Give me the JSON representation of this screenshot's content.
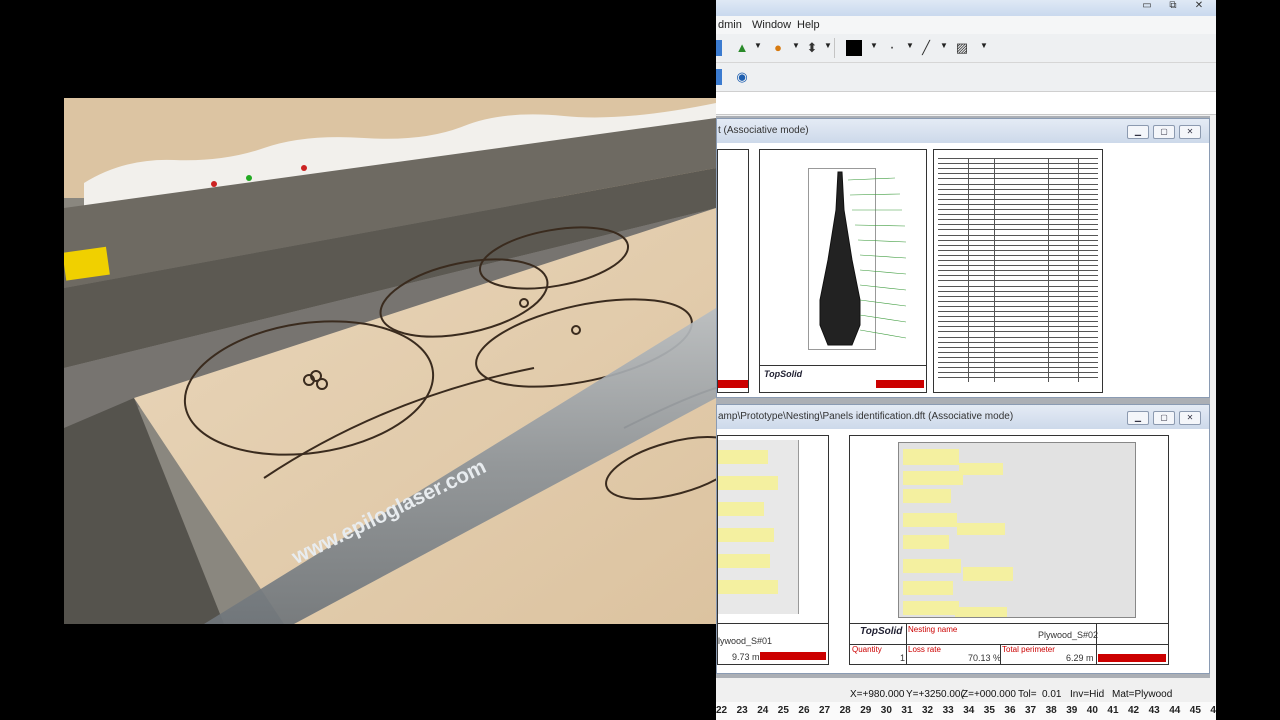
{
  "video": {
    "watermark": "www.epiloglaser.com"
  },
  "app": {
    "menu": {
      "admin": "dmin",
      "window": "Window",
      "help": "Help"
    },
    "window_controls": {
      "minimize": "▭",
      "restore": "⧉",
      "close": "✕"
    },
    "child_windows": [
      {
        "title": "t (Associative mode)",
        "title_block_logo": "TopSolid"
      },
      {
        "title": "amp\\Prototype\\Nesting\\Panels identification.dft (Associative mode)",
        "left_sheet": {
          "name": "lywood_S#01",
          "perimeter": "9.73 m"
        },
        "right_sheet": {
          "logo": "TopSolid",
          "nesting_name_label": "Nesting name",
          "nesting_name": "Plywood_S#02",
          "quantity_label": "Quantity",
          "quantity": "1",
          "loss_rate_label": "Loss rate",
          "loss_rate": "70.13 %",
          "total_perimeter_label": "Total perimeter",
          "total_perimeter": "6.29 m"
        }
      }
    ],
    "status": {
      "x": "X=+980.000",
      "y": "Y=+3250.00(",
      "z": "Z=+000.000",
      "tol": "Tol=",
      "tol_value": "0.01",
      "inv": "Inv=Hid",
      "mat": "Mat=Plywood"
    },
    "ruler_numbers": [
      "22",
      "23",
      "24",
      "25",
      "26",
      "27",
      "28",
      "29",
      "30",
      "31",
      "32",
      "33",
      "34",
      "35",
      "36",
      "37",
      "38",
      "39",
      "40",
      "41",
      "42",
      "43",
      "44",
      "45",
      "4"
    ]
  },
  "colors": {
    "wood": "#e8d2b4",
    "laser_head": "#9aa0a4",
    "title_bar": "#cdd9ea",
    "mdi_bg": "#abafb5",
    "part_label_bg": "#f4f0a0",
    "title_block_red": "#cc0000"
  }
}
